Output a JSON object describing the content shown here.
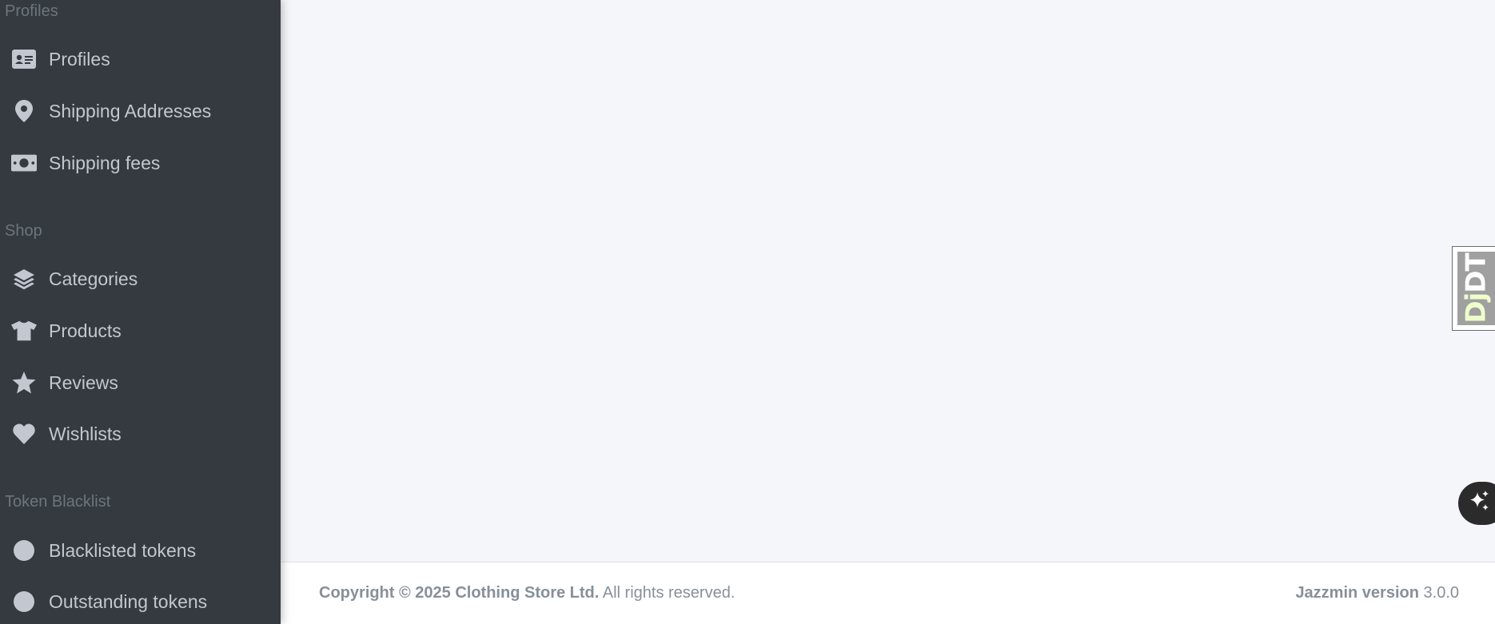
{
  "sidebar": {
    "sections": [
      {
        "header": "Profiles",
        "items": [
          {
            "label": "Profiles",
            "icon": "id-card-icon"
          },
          {
            "label": "Shipping Addresses",
            "icon": "map-marker-icon"
          },
          {
            "label": "Shipping fees",
            "icon": "money-bill-icon"
          }
        ]
      },
      {
        "header": "Shop",
        "items": [
          {
            "label": "Categories",
            "icon": "layer-group-icon"
          },
          {
            "label": "Products",
            "icon": "tshirt-icon"
          },
          {
            "label": "Reviews",
            "icon": "star-icon"
          },
          {
            "label": "Wishlists",
            "icon": "heart-icon"
          }
        ]
      },
      {
        "header": "Token Blacklist",
        "items": [
          {
            "label": "Blacklisted tokens",
            "icon": "circle-icon"
          },
          {
            "label": "Outstanding tokens",
            "icon": "circle-icon"
          }
        ]
      }
    ]
  },
  "footer": {
    "copyright": "Copyright © 2025 Clothing Store Ltd.",
    "rights": " All rights reserved.",
    "version_label": "Jazzmin version",
    "version_number": " 3.0.0"
  },
  "debug_toolbar": {
    "handle_dj": "Dj",
    "handle_dt": "DT"
  },
  "colors": {
    "sidebar_bg": "#343a40",
    "sidebar_text": "#c2c7d0",
    "sidebar_header": "#6c757d",
    "content_bg": "#f4f6f9",
    "footer_text": "#869099"
  }
}
